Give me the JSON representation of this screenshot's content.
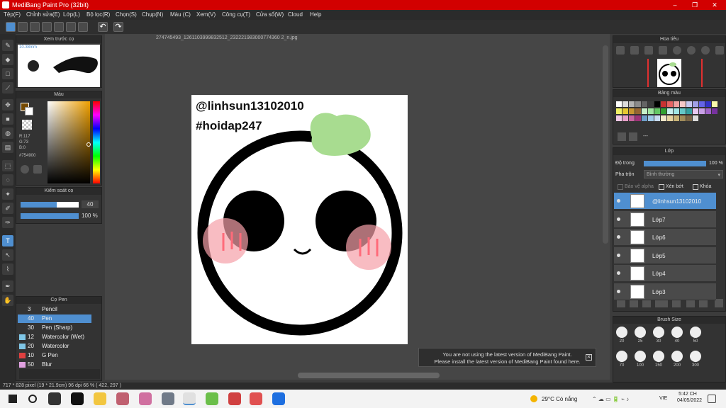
{
  "app": {
    "title": "MediBang Paint Pro (32bit)",
    "window_buttons": [
      "–",
      "❐",
      "✕"
    ]
  },
  "menu": [
    "Tệp(F)",
    "Chỉnh sửa(E)",
    "Lớp(L)",
    "Bộ lọc(R)",
    "Chọn(S)",
    "Chụp(N)",
    "Màu (C)",
    "Xem(V)",
    "Công cụ(T)",
    "Cửa sổ(W)",
    "Cloud",
    "Help"
  ],
  "document": {
    "tab": "274745493_1261103999832512_232221983000774360 2_n.jpg"
  },
  "canvas": {
    "line1": "@linhsun13102010",
    "line2": "#hoidap247"
  },
  "brush_preview": {
    "title": "Xem trước cọ",
    "size": "10.38mm"
  },
  "color_panel": {
    "title": "Màu",
    "r": "R:117",
    "g": "G:73",
    "b": "B:0",
    "hex": "#754900"
  },
  "brush_control": {
    "title": "Kiểm soát cọ",
    "size_value": "40",
    "opacity_value": "100 %",
    "size_fraction": 0.62,
    "opacity_fraction": 1.0
  },
  "brush_list": {
    "title": "Cọ Pen",
    "items": [
      {
        "size": "3",
        "name": "Pencil",
        "color": "#333333"
      },
      {
        "size": "40",
        "name": "Pen",
        "color": "#4f8fd0"
      },
      {
        "size": "30",
        "name": "Pen (Sharp)",
        "color": "#333333"
      },
      {
        "size": "12",
        "name": "Watercolor (Wet)",
        "color": "#7fc6e6"
      },
      {
        "size": "20",
        "name": "Watercolor",
        "color": "#7fc6e6"
      },
      {
        "size": "10",
        "name": "G Pen",
        "color": "#e04040"
      },
      {
        "size": "50",
        "name": "Blur",
        "color": "#e0a0e0"
      }
    ]
  },
  "navigator": {
    "title": "Hoa tiêu"
  },
  "palette": {
    "title": "Bảng màu",
    "extra": "---"
  },
  "layers": {
    "title": "Lớp",
    "opacity_label": "Độ trong",
    "opacity_value": "100 %",
    "opacity_fraction": 1.0,
    "blend_label": "Pha trộn",
    "blend_value": "Bình thường",
    "alpha_protect": "Bảo vệ alpha",
    "clipping": "Xén bớt",
    "lock": "Khóa",
    "items": [
      "@linhsun13102010",
      "Lớp7",
      "Lớp6",
      "Lớp5",
      "Lớp4",
      "Lớp3"
    ]
  },
  "brush_size": {
    "title": "Brush Size",
    "row1": [
      "20",
      "25",
      "30",
      "40",
      "50"
    ],
    "row2": [
      "70",
      "100",
      "150",
      "200",
      "300"
    ]
  },
  "notification": {
    "line1": "You are not using the latest version of MediBang Paint.",
    "line2": "Please install the latest version of MediBang Paint found here."
  },
  "status": {
    "text": "717 * 828 pixel   (19 * 21.9cm)   96 dpi   66 %   ( 422, 297 )"
  },
  "taskbar": {
    "weather": "29°C  Có nắng",
    "lang": "VIE",
    "time": "5:42 CH",
    "date": "04/05/2022"
  },
  "colors": {
    "accent": "#4f8fd0",
    "title_red": "#d20000",
    "main_color": "#754900",
    "leaf": "#a8dc90",
    "blush": "#f5a0a8"
  }
}
